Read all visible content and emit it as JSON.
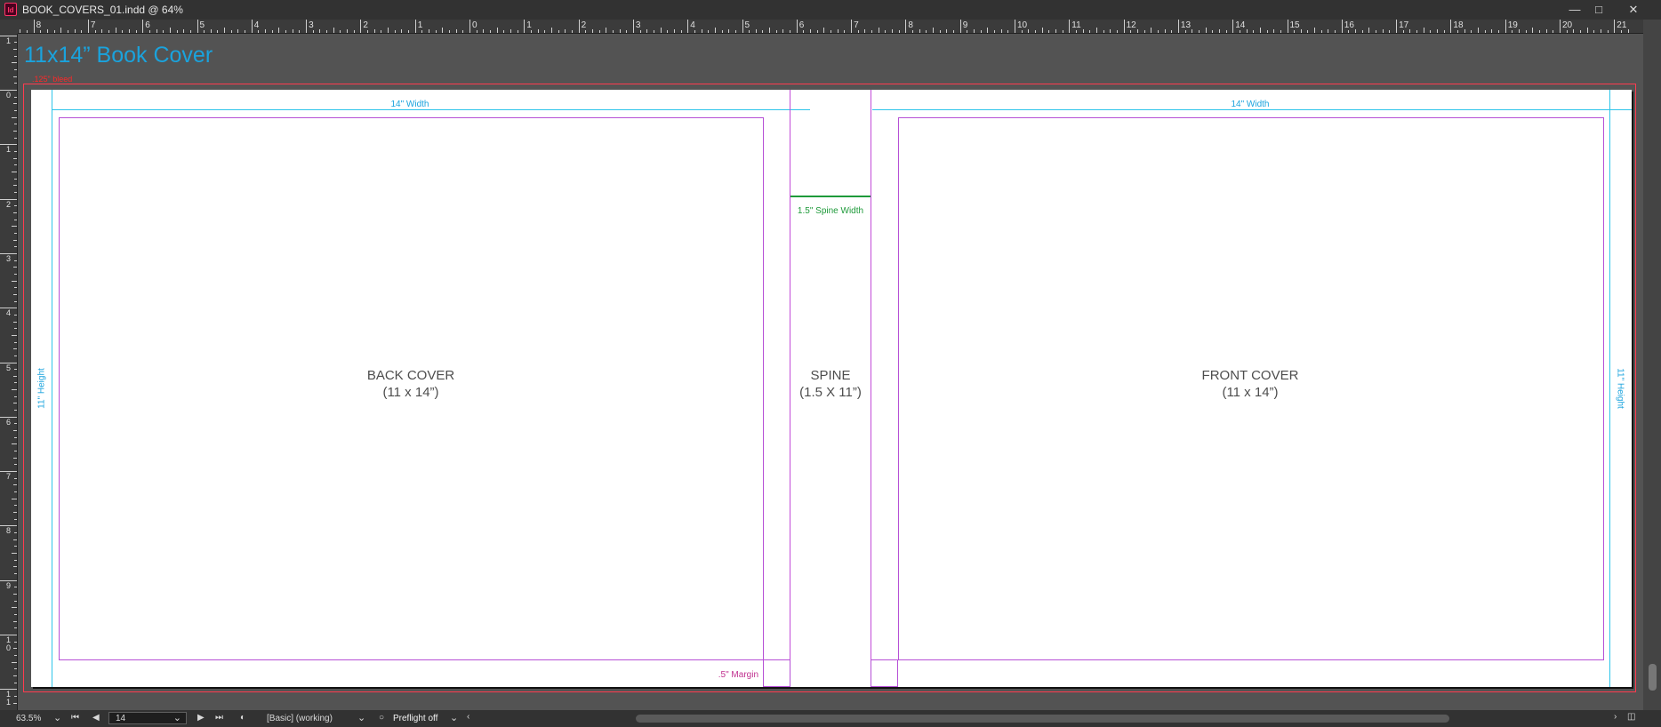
{
  "window": {
    "title": "BOOK_COVERS_01.indd @ 64%",
    "app_icon_text": "Id",
    "controls": {
      "minimize": "—",
      "maximize": "□",
      "close": "✕"
    }
  },
  "rulers": {
    "horizontal_labels": [
      "8",
      "7",
      "6",
      "5",
      "4",
      "3",
      "2",
      "1",
      "0",
      "1",
      "2",
      "3",
      "4",
      "5",
      "6",
      "7",
      "8",
      "9",
      "10",
      "11",
      "12",
      "13",
      "14",
      "15",
      "16",
      "17",
      "18",
      "19",
      "20",
      "21"
    ],
    "vertical_labels": [
      "1",
      "0",
      "1",
      "2",
      "3",
      "4",
      "5",
      "6",
      "7",
      "8",
      "9",
      "1\n0",
      "1\n1"
    ]
  },
  "document": {
    "heading": "11x14” Book Cover",
    "bleed_label": ".125\" bleed",
    "back_width_label": "14\" Width",
    "front_width_label": "14\" Width",
    "left_height_label": "11\" Height",
    "right_height_label": "11\" Height",
    "spine_width_label": "1.5\" Spine Width",
    "margin_label": ".5\" Margin",
    "back_cover": {
      "title": "BACK COVER",
      "size": "(11 x 14”)"
    },
    "spine": {
      "title": "SPINE",
      "size": "(1.5 X 11”)"
    },
    "front_cover": {
      "title": "FRONT COVER",
      "size": "(11 x 14”)"
    }
  },
  "statusbar": {
    "zoom": "63.5%",
    "page_number": "14",
    "profile": "[Basic] (working)",
    "preflight": "Preflight off"
  },
  "colors": {
    "guide_cyan": "#2ec5ea",
    "margin_violet": "#c24cd8",
    "bleed_red": "#ff3b4f",
    "heading_blue": "#1aa3dd",
    "spine_green": "#1e9a3a"
  }
}
